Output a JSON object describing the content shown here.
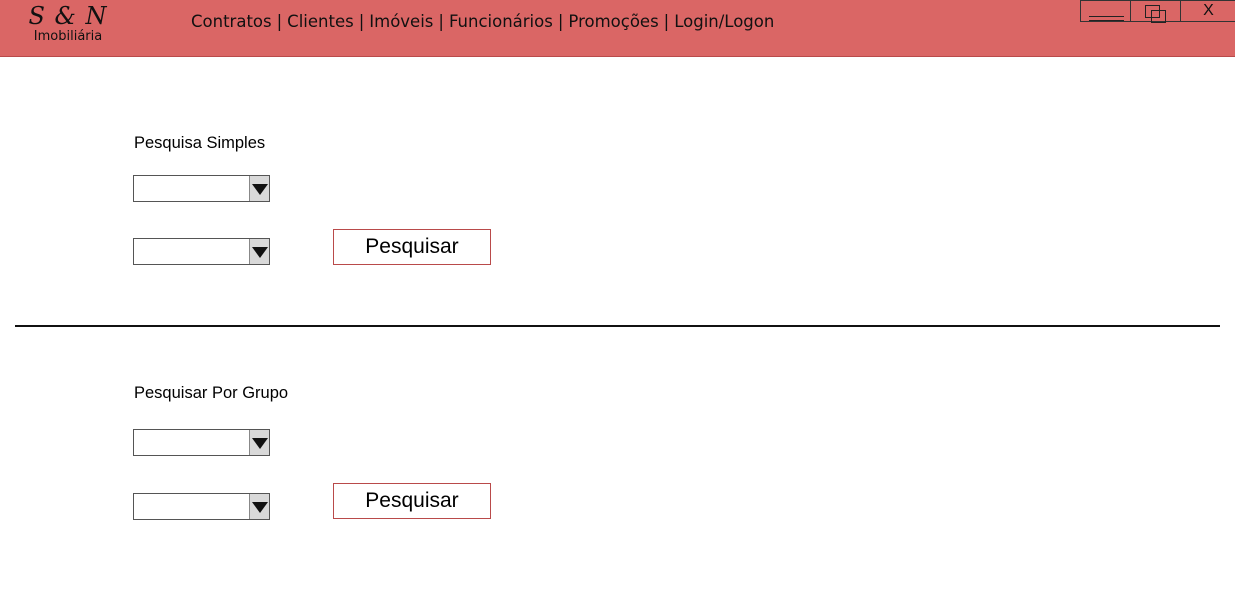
{
  "header": {
    "logo_mark": "S & N",
    "logo_sub": "Imobiliária",
    "nav": [
      {
        "label": "Contratos"
      },
      {
        "label": "Clientes"
      },
      {
        "label": "Imóveis"
      },
      {
        "label": "Funcionários"
      },
      {
        "label": "Promoções"
      },
      {
        "label": "Login/Logon"
      }
    ],
    "separator": "|",
    "window": {
      "close_label": "X"
    },
    "bar_color": "#da6665"
  },
  "simple_search": {
    "label": "Pesquisa Simples",
    "button_label": "Pesquisar",
    "selects": [
      "",
      ""
    ]
  },
  "group_search": {
    "label": "Pesquisar Por Grupo",
    "button_label": "Pesquisar",
    "selects": [
      "",
      ""
    ]
  }
}
